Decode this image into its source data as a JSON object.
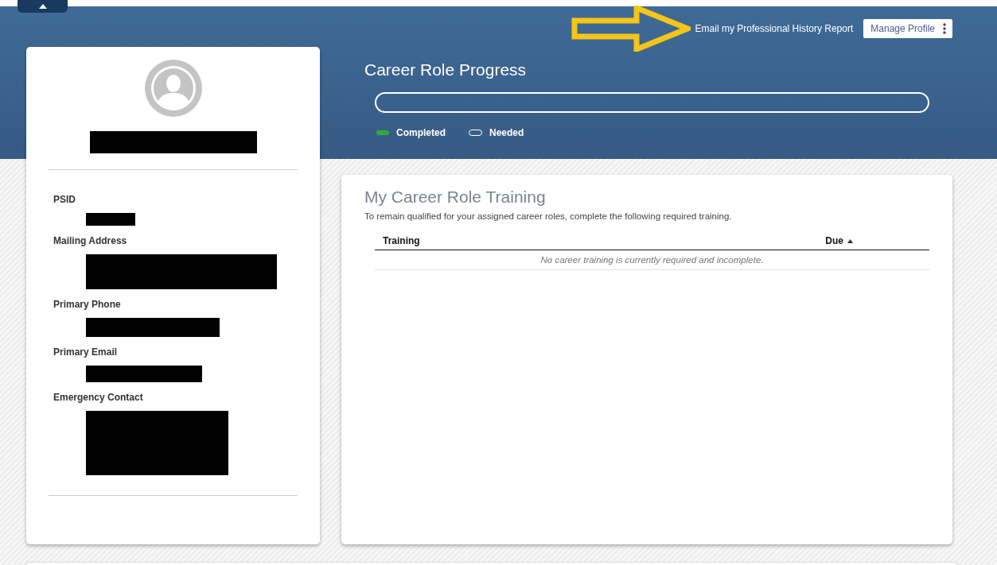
{
  "header": {
    "email_link": "Email my Professional History Report",
    "manage_button": "Manage Profile"
  },
  "progress": {
    "title": "Career Role Progress",
    "level": 0,
    "legend": [
      {
        "kind": "completed",
        "label": "Completed"
      },
      {
        "kind": "needed",
        "label": "Needed"
      }
    ]
  },
  "profile": {
    "fields": [
      {
        "label": "PSID"
      },
      {
        "label": "Mailing Address"
      },
      {
        "label": "Primary Phone"
      },
      {
        "label": "Primary Email"
      },
      {
        "label": "Emergency Contact"
      }
    ]
  },
  "training": {
    "title": "My Career Role Training",
    "description": "To remain qualified for your assigned career roles, complete the following required training.",
    "columns": [
      "Training",
      "Due"
    ],
    "empty_message": "No career training is currently required and incomplete."
  }
}
